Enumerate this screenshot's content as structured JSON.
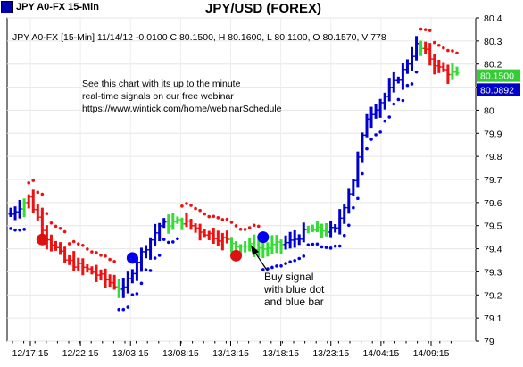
{
  "window": {
    "symbol_label": "JPY A0-FX 15-Min",
    "pair_title": "JPY/USD (FOREX)"
  },
  "chart_data": {
    "type": "bar",
    "subtype": "ohlc-price-bars-with-stop-dots",
    "info_line": "JPY A0-FX [15-Min] 11/14/12 -0.0100 C 80.1500, H 80.1600, L 80.1100, O 80.1570, V 778",
    "promo_text": [
      "See this chart with its up to the minute",
      "real-time signals on our free webinar",
      "https://www.wintick.com/home/webinarSchedule"
    ],
    "annotation": [
      "Buy signal",
      "with blue dot",
      "and blue bar"
    ],
    "ylim": [
      79,
      80.4
    ],
    "yticks": [
      "80.4",
      "80.3",
      "80.2",
      "80.1",
      "80",
      "79.9",
      "79.8",
      "79.7",
      "79.6",
      "79.5",
      "79.4",
      "79.3",
      "79.2",
      "79.1",
      "79"
    ],
    "xticks": [
      "12/17:15",
      "12/22:15",
      "13/03:15",
      "13/08:15",
      "13/13:15",
      "13/18:15",
      "13/23:15",
      "14/04:15",
      "14/09:15"
    ],
    "price_tags": [
      {
        "value": 80.15,
        "label": "80.1500",
        "color": "#33cc33"
      },
      {
        "value": 80.0892,
        "label": "80.0892",
        "color": "#0000cc"
      }
    ],
    "bar_colors": {
      "up": "#0000cc",
      "neutral": "#33dd33",
      "down": "#ee1111"
    },
    "key_points": [
      {
        "x": 0,
        "y": 79.55
      },
      {
        "x": 4,
        "y": 79.62
      },
      {
        "x": 8,
        "y": 79.45
      },
      {
        "x": 12,
        "y": 79.35
      },
      {
        "x": 18,
        "y": 79.3
      },
      {
        "x": 25,
        "y": 79.22
      },
      {
        "x": 28,
        "y": 79.35
      },
      {
        "x": 33,
        "y": 79.5
      },
      {
        "x": 38,
        "y": 79.52
      },
      {
        "x": 43,
        "y": 79.47
      },
      {
        "x": 50,
        "y": 79.42
      },
      {
        "x": 56,
        "y": 79.4
      },
      {
        "x": 62,
        "y": 79.43
      },
      {
        "x": 66,
        "y": 79.48
      },
      {
        "x": 72,
        "y": 79.48
      },
      {
        "x": 76,
        "y": 79.7
      },
      {
        "x": 79,
        "y": 79.97
      },
      {
        "x": 83,
        "y": 80.06
      },
      {
        "x": 87,
        "y": 80.17
      },
      {
        "x": 90,
        "y": 80.28
      },
      {
        "x": 92,
        "y": 80.25
      },
      {
        "x": 95,
        "y": 80.18
      },
      {
        "x": 99,
        "y": 80.15
      }
    ],
    "signal_markers": [
      {
        "x": 7,
        "y": 79.44,
        "color": "#dd1111"
      },
      {
        "x": 27,
        "y": 79.36,
        "color": "#0000ee"
      },
      {
        "x": 50,
        "y": 79.37,
        "color": "#dd1111"
      },
      {
        "x": 56,
        "y": 79.45,
        "color": "#0000ee"
      }
    ],
    "grid": true
  }
}
